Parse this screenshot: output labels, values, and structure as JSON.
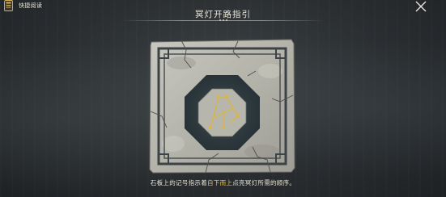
{
  "header": {
    "quick_read_label": "快捷阅读",
    "title": "冥灯开路指引"
  },
  "caption": {
    "before": "石板上的记号指示着",
    "highlight": "自下而上",
    "after": "点亮冥灯所需的顺序。"
  },
  "colors": {
    "highlight": "#f0c648",
    "symbol_gold": "#d8b44a",
    "stone": "#b7b6ac",
    "octagon_dark": "#2f3a3f"
  },
  "icons": {
    "quick_read": "book-icon",
    "close": "close-icon"
  }
}
